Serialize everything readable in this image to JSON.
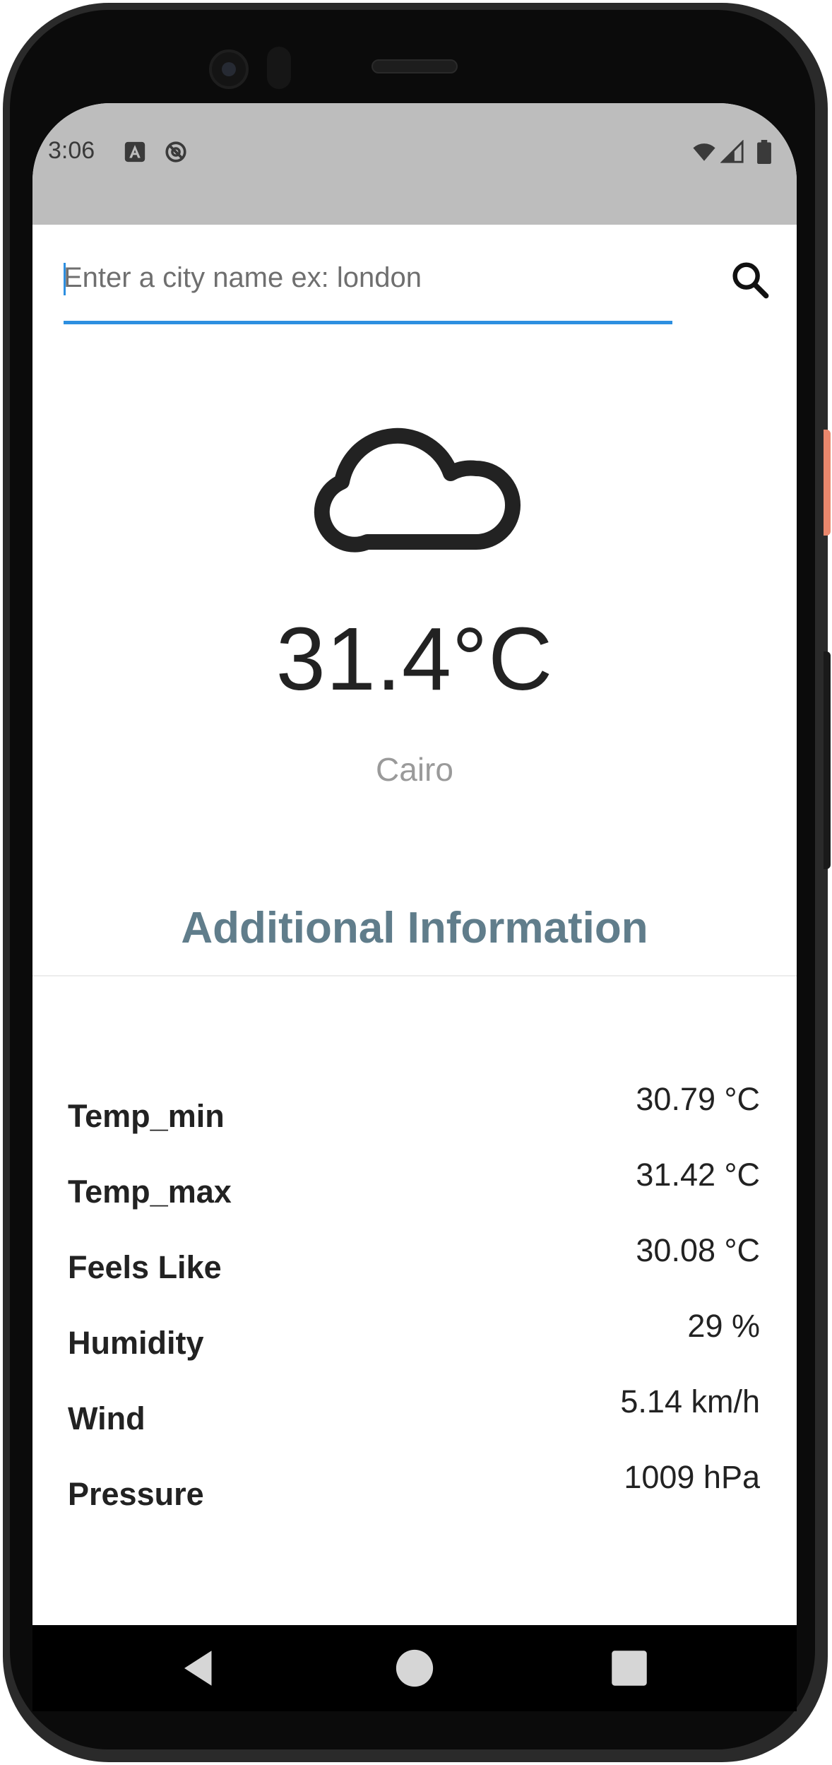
{
  "status_bar": {
    "time": "3:06",
    "icons": [
      "font-a-icon",
      "no-sync-icon",
      "wifi-icon",
      "signal-icon",
      "battery-icon"
    ]
  },
  "search": {
    "placeholder": "Enter a city name ex: london",
    "value": "",
    "button_icon": "search-icon"
  },
  "weather": {
    "icon": "cloud-icon",
    "temperature": "31.4°C",
    "city": "Cairo"
  },
  "additional": {
    "title": "Additional Information",
    "items": [
      {
        "label": "Temp_min",
        "value": "30.79 °C"
      },
      {
        "label": "Temp_max",
        "value": "31.42 °C"
      },
      {
        "label": "Feels Like",
        "value": "30.08 °C"
      },
      {
        "label": "Humidity",
        "value": "29 %"
      },
      {
        "label": "Wind",
        "value": "5.14 km/h"
      },
      {
        "label": "Pressure",
        "value": "1009 hPa"
      }
    ]
  },
  "navigation": {
    "buttons": [
      "back-icon",
      "home-icon",
      "recents-icon"
    ]
  },
  "colors": {
    "accent": "#2d8fe0",
    "section_title": "#607d8b",
    "status_bar": "#bdbdbd"
  }
}
